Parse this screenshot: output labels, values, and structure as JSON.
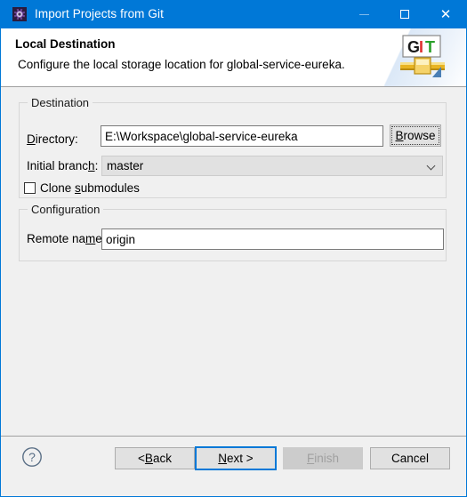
{
  "window": {
    "title": "Import Projects from Git",
    "icon": "eclipse-gear-icon",
    "accent_color": "#0078d7",
    "minimize_label": "Minimize",
    "maximize_label": "Maximize",
    "close_label": "Close"
  },
  "header": {
    "title": "Local Destination",
    "description": "Configure the local storage location for global-service-eureka.",
    "logo": {
      "name": "git-logo",
      "letters": [
        "G",
        "I",
        "T"
      ],
      "letter_colors": [
        "#1a1a1a",
        "#e03030",
        "#2aa02a"
      ]
    }
  },
  "destination": {
    "legend": "Destination",
    "directory": {
      "label_pre": "D",
      "label_mnemonic": "",
      "label": "Directory:",
      "label_before": "",
      "label_mn": "D",
      "label_after": "irectory:",
      "value": "E:\\Workspace\\global-service-eureka",
      "placeholder": ""
    },
    "browse": {
      "label_before": "",
      "label_mn": "B",
      "label_after": "rowse"
    },
    "initial_branch": {
      "label_before": "Initial branc",
      "label_mn": "h",
      "label_after": ":",
      "value": "master",
      "options": [
        "master"
      ]
    },
    "clone_submodules": {
      "label_before": "Clone ",
      "label_mn": "s",
      "label_after": "ubmodules",
      "checked": false
    }
  },
  "configuration": {
    "legend": "Configuration",
    "remote_name": {
      "label_before": "Remote na",
      "label_mn": "m",
      "label_after": "e:",
      "value": "origin",
      "placeholder": ""
    }
  },
  "footer": {
    "help_label": "?",
    "buttons": [
      {
        "id": "back",
        "before": "< ",
        "mn": "B",
        "after": "ack",
        "state": "enabled"
      },
      {
        "id": "next",
        "before": "",
        "mn": "N",
        "after": "ext >",
        "state": "focused"
      },
      {
        "id": "finish",
        "before": "",
        "mn": "F",
        "after": "inish",
        "state": "disabled"
      },
      {
        "id": "cancel",
        "before": "",
        "mn": "",
        "after": "Cancel",
        "state": "enabled"
      }
    ]
  }
}
